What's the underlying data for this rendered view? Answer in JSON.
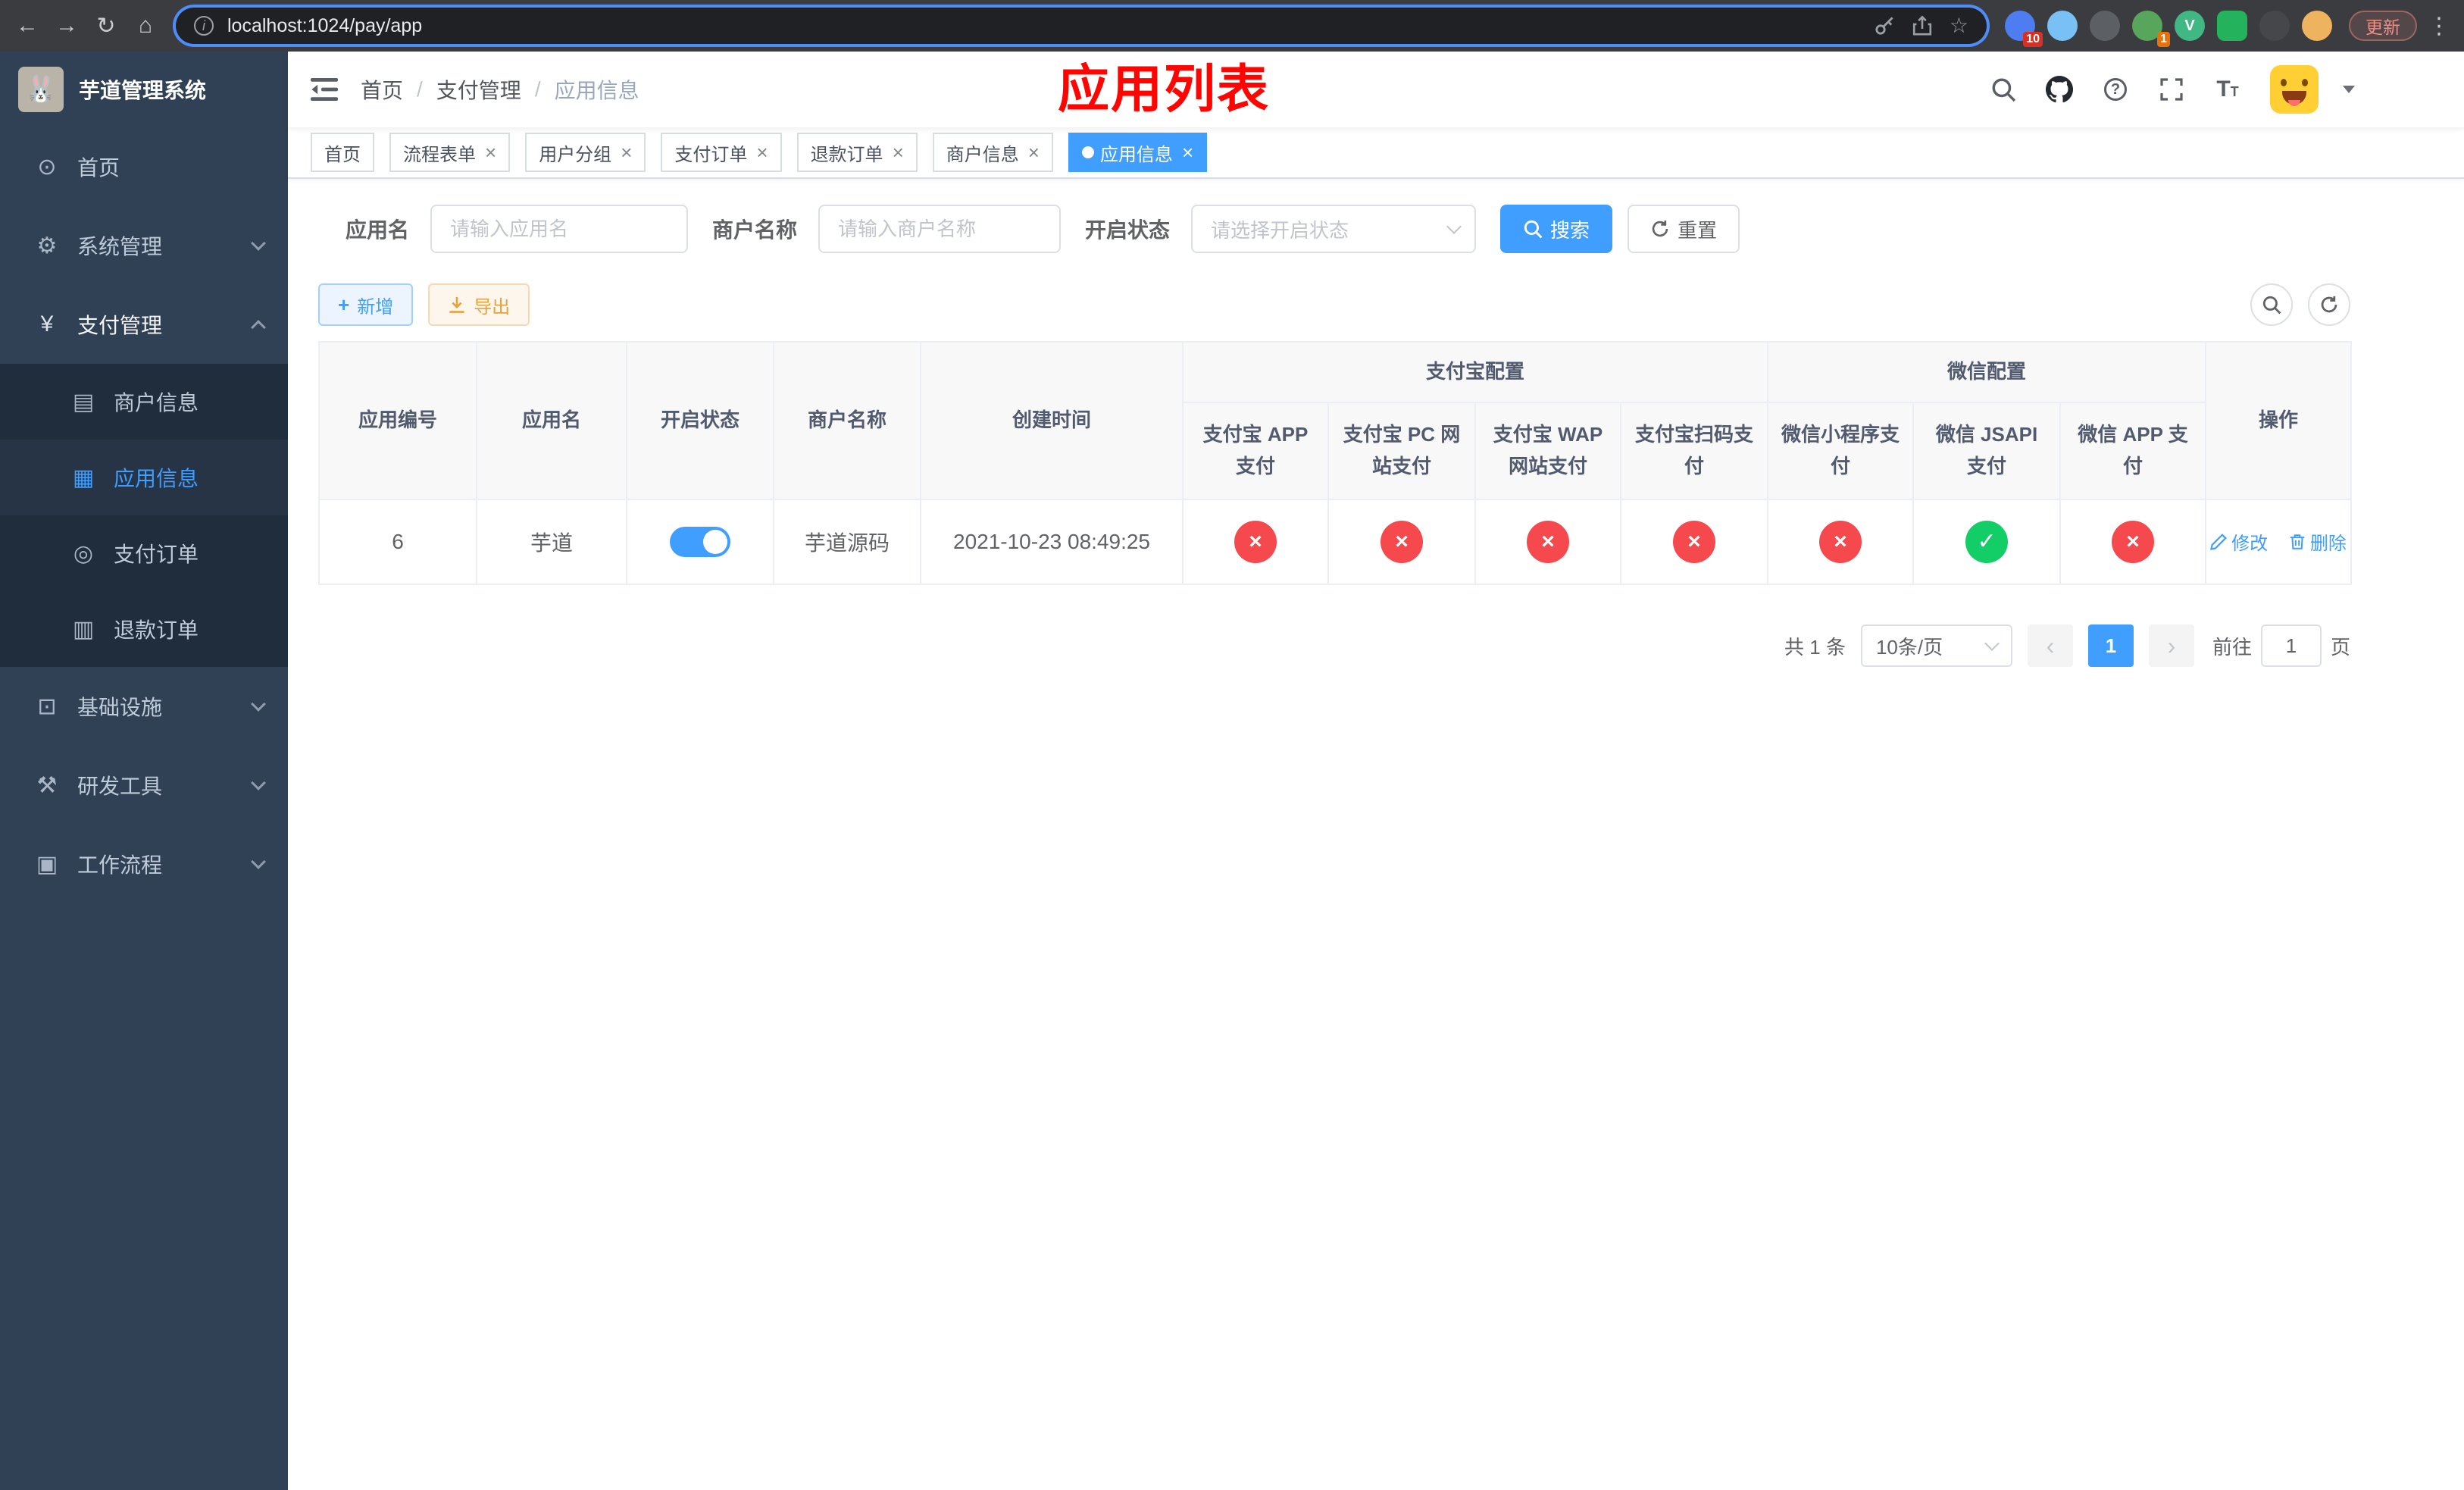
{
  "browser": {
    "url": "localhost:1024/pay/app",
    "update_label": "更新",
    "extensions": {
      "badge_first": "10",
      "badge_fourth": "1"
    }
  },
  "icons": {
    "back": "←",
    "forward": "→",
    "reload": "↻",
    "home": "⌂",
    "star": "☆",
    "menu_dots": "⋮",
    "logo_emoji": "🐰"
  },
  "glyphs": {
    "allow": "✓",
    "deny": "×",
    "close": "×",
    "prev": "‹",
    "next": "›"
  },
  "sidebar": {
    "title": "芋道管理系统",
    "items": [
      {
        "label": "首页",
        "glyph": "⊙"
      },
      {
        "label": "系统管理",
        "glyph": "⚙"
      },
      {
        "label": "支付管理",
        "glyph": "¥"
      },
      {
        "label": "商户信息",
        "glyph": "▤"
      },
      {
        "label": "应用信息",
        "glyph": "▦"
      },
      {
        "label": "支付订单",
        "glyph": "◎"
      },
      {
        "label": "退款订单",
        "glyph": "▥"
      },
      {
        "label": "基础设施",
        "glyph": "⊡"
      },
      {
        "label": "研发工具",
        "glyph": "⚒"
      },
      {
        "label": "工作流程",
        "glyph": "▣"
      }
    ]
  },
  "navbar": {
    "breadcrumb": [
      "首页",
      "支付管理",
      "应用信息"
    ],
    "font_icon_text": "T"
  },
  "overlay_title": "应用列表",
  "tabs": [
    {
      "label": "首页"
    },
    {
      "label": "流程表单"
    },
    {
      "label": "用户分组"
    },
    {
      "label": "支付订单"
    },
    {
      "label": "退款订单"
    },
    {
      "label": "商户信息"
    },
    {
      "label": "应用信息"
    }
  ],
  "filters": {
    "app_name_label": "应用名",
    "app_name_placeholder": "请输入应用名",
    "merchant_label": "商户名称",
    "merchant_placeholder": "请输入商户名称",
    "status_label": "开启状态",
    "status_placeholder": "请选择开启状态",
    "search_label": "搜索",
    "reset_label": "重置"
  },
  "toolbar": {
    "add_label": "新增",
    "export_label": "导出"
  },
  "table": {
    "group_headers": {
      "alipay": "支付宝配置",
      "wechat": "微信配置"
    },
    "columns": [
      "应用编号",
      "应用名",
      "开启状态",
      "商户名称",
      "创建时间",
      "支付宝 APP 支付",
      "支付宝 PC 网站支付",
      "支付宝 WAP 网站支付",
      "支付宝扫码支付",
      "微信小程序支付",
      "微信 JSAPI 支付",
      "微信 APP 支付",
      "操作"
    ],
    "rows": [
      {
        "id": "6",
        "name": "芋道",
        "status_on": true,
        "merchant": "芋道源码",
        "created_at": "2021-10-23 08:49:25",
        "configs": [
          false,
          false,
          false,
          false,
          false,
          true,
          false
        ],
        "edit_label": "修改",
        "delete_label": "删除"
      }
    ]
  },
  "pagination": {
    "total": "共 1 条",
    "page_size": "10条/页",
    "page": "1",
    "goto_prefix": "前往",
    "goto_value": "1",
    "goto_suffix": "页"
  },
  "colors": {
    "primary": "#409eff",
    "danger": "#f5494d",
    "success": "#13ce66",
    "warning": "#e6a23c",
    "sidebar_bg": "#304156",
    "submenu_bg": "#1f2d3d",
    "overlay_title_red": "#ff0400"
  }
}
